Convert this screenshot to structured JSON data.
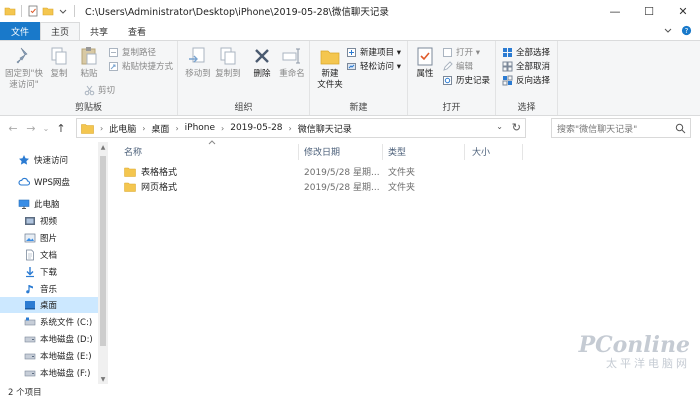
{
  "window": {
    "title": "C:\\Users\\Administrator\\Desktop\\iPhone\\2019-05-28\\微信聊天记录",
    "minimize": "—",
    "maximize": "☐",
    "close": "✕"
  },
  "ribbon_tabs": {
    "file": "文件",
    "home": "主页",
    "share": "共享",
    "view": "查看",
    "collapse_icon": "chevron-down-icon",
    "help_icon": "help-icon"
  },
  "clipboard": {
    "pin_label": "固定到\"快\n速访问\"",
    "copy_label": "复制",
    "paste_label": "粘贴",
    "copy_path_label": "复制路径",
    "paste_shortcut_label": "粘贴快捷方式",
    "cut_label": "剪切",
    "group_label": "剪贴板"
  },
  "organize": {
    "move_to_label": "移动到",
    "copy_to_label": "复制到",
    "delete_label": "删除",
    "rename_label": "重命名",
    "group_label": "组织"
  },
  "new_group": {
    "new_folder_label": "新建\n文件夹",
    "new_item_label": "新建项目 ▾",
    "easy_access_label": "轻松访问 ▾",
    "group_label": "新建"
  },
  "open_group": {
    "properties_label": "属性",
    "open_label": "打开 ▾",
    "edit_label": "编辑",
    "history_label": "历史记录",
    "group_label": "打开"
  },
  "select_group": {
    "select_all_label": "全部选择",
    "select_none_label": "全部取消",
    "invert_label": "反向选择",
    "group_label": "选择"
  },
  "address": {
    "crumbs": [
      "此电脑",
      "桌面",
      "iPhone",
      "2019-05-28",
      "微信聊天记录"
    ],
    "search_placeholder": "搜索\"微信聊天记录\""
  },
  "nav_pane": {
    "items": [
      {
        "label": "快速访问",
        "icon": "star-icon"
      },
      {
        "label": "WPS网盘",
        "icon": "cloud-icon"
      },
      {
        "label": "此电脑",
        "icon": "computer-icon"
      },
      {
        "label": "视频",
        "icon": "video-icon"
      },
      {
        "label": "图片",
        "icon": "picture-icon"
      },
      {
        "label": "文档",
        "icon": "document-icon"
      },
      {
        "label": "下载",
        "icon": "download-icon"
      },
      {
        "label": "音乐",
        "icon": "music-icon"
      },
      {
        "label": "桌面",
        "icon": "desktop-icon"
      },
      {
        "label": "系统文件 (C:)",
        "icon": "drive-icon"
      },
      {
        "label": "本地磁盘 (D:)",
        "icon": "drive-icon"
      },
      {
        "label": "本地磁盘 (E:)",
        "icon": "drive-icon"
      },
      {
        "label": "本地磁盘 (F:)",
        "icon": "drive-icon"
      }
    ],
    "selected": "桌面"
  },
  "file_list": {
    "columns": {
      "name": "名称",
      "modified": "修改日期",
      "type": "类型",
      "size": "大小"
    },
    "rows": [
      {
        "name": "表格格式",
        "modified": "2019/5/28 星期...",
        "type": "文件夹",
        "size": ""
      },
      {
        "name": "网页格式",
        "modified": "2019/5/28 星期...",
        "type": "文件夹",
        "size": ""
      }
    ]
  },
  "status": {
    "item_count": "2 个项目"
  },
  "watermark": {
    "brand": "PConline",
    "subtitle": "太平洋电脑网"
  },
  "colors": {
    "accent": "#1979ca",
    "folder": "#f4c64f",
    "selection": "#cce8ff",
    "ribbon_bg": "#f5f6f7"
  }
}
